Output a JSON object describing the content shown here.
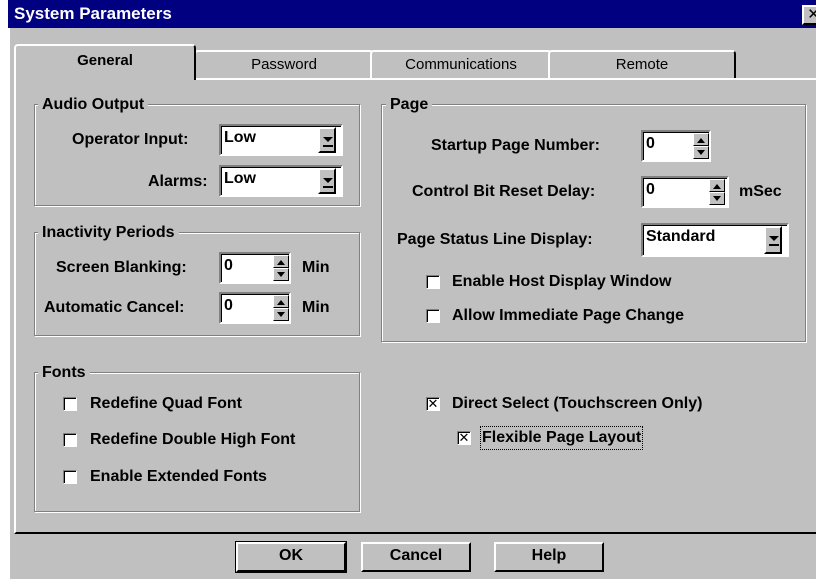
{
  "window": {
    "title": "System Parameters",
    "close_glyph": "✕"
  },
  "tabs": [
    {
      "label": "General",
      "active": true
    },
    {
      "label": "Password",
      "active": false
    },
    {
      "label": "Communications",
      "active": false
    },
    {
      "label": "Remote",
      "active": false
    }
  ],
  "audio_output": {
    "legend": "Audio Output",
    "operator_input": {
      "label": "Operator Input:",
      "value": "Low"
    },
    "alarms": {
      "label": "Alarms:",
      "value": "Low"
    }
  },
  "inactivity": {
    "legend": "Inactivity Periods",
    "screen_blanking": {
      "label": "Screen Blanking:",
      "value": "0",
      "unit": "Min"
    },
    "automatic_cancel": {
      "label": "Automatic Cancel:",
      "value": "0",
      "unit": "Min"
    }
  },
  "fonts": {
    "legend": "Fonts",
    "redefine_quad": {
      "label": "Redefine Quad Font",
      "checked": false
    },
    "redefine_double_high": {
      "label": "Redefine Double High Font",
      "checked": false
    },
    "enable_extended": {
      "label": "Enable Extended Fonts",
      "checked": false
    }
  },
  "page": {
    "legend": "Page",
    "startup_page_number": {
      "label": "Startup Page Number:",
      "value": "0"
    },
    "control_bit_reset_delay": {
      "label": "Control Bit Reset Delay:",
      "value": "0",
      "unit": "mSec"
    },
    "page_status_line_display": {
      "label": "Page Status Line Display:",
      "value": "Standard"
    },
    "enable_host_display_window": {
      "label": "Enable Host Display Window",
      "checked": false
    },
    "allow_immediate_page_change": {
      "label": "Allow Immediate Page Change",
      "checked": false
    }
  },
  "direct_select": {
    "label": "Direct Select (Touchscreen Only)",
    "checked": true,
    "mark": "✕"
  },
  "flexible_page_layout": {
    "label": "Flexible Page Layout",
    "checked": true,
    "mark": "✕"
  },
  "buttons": {
    "ok": "OK",
    "cancel": "Cancel",
    "help": "Help"
  },
  "colors": {
    "title_bar": "#000080",
    "face": "#c0c0c0",
    "field": "#ffffff"
  }
}
